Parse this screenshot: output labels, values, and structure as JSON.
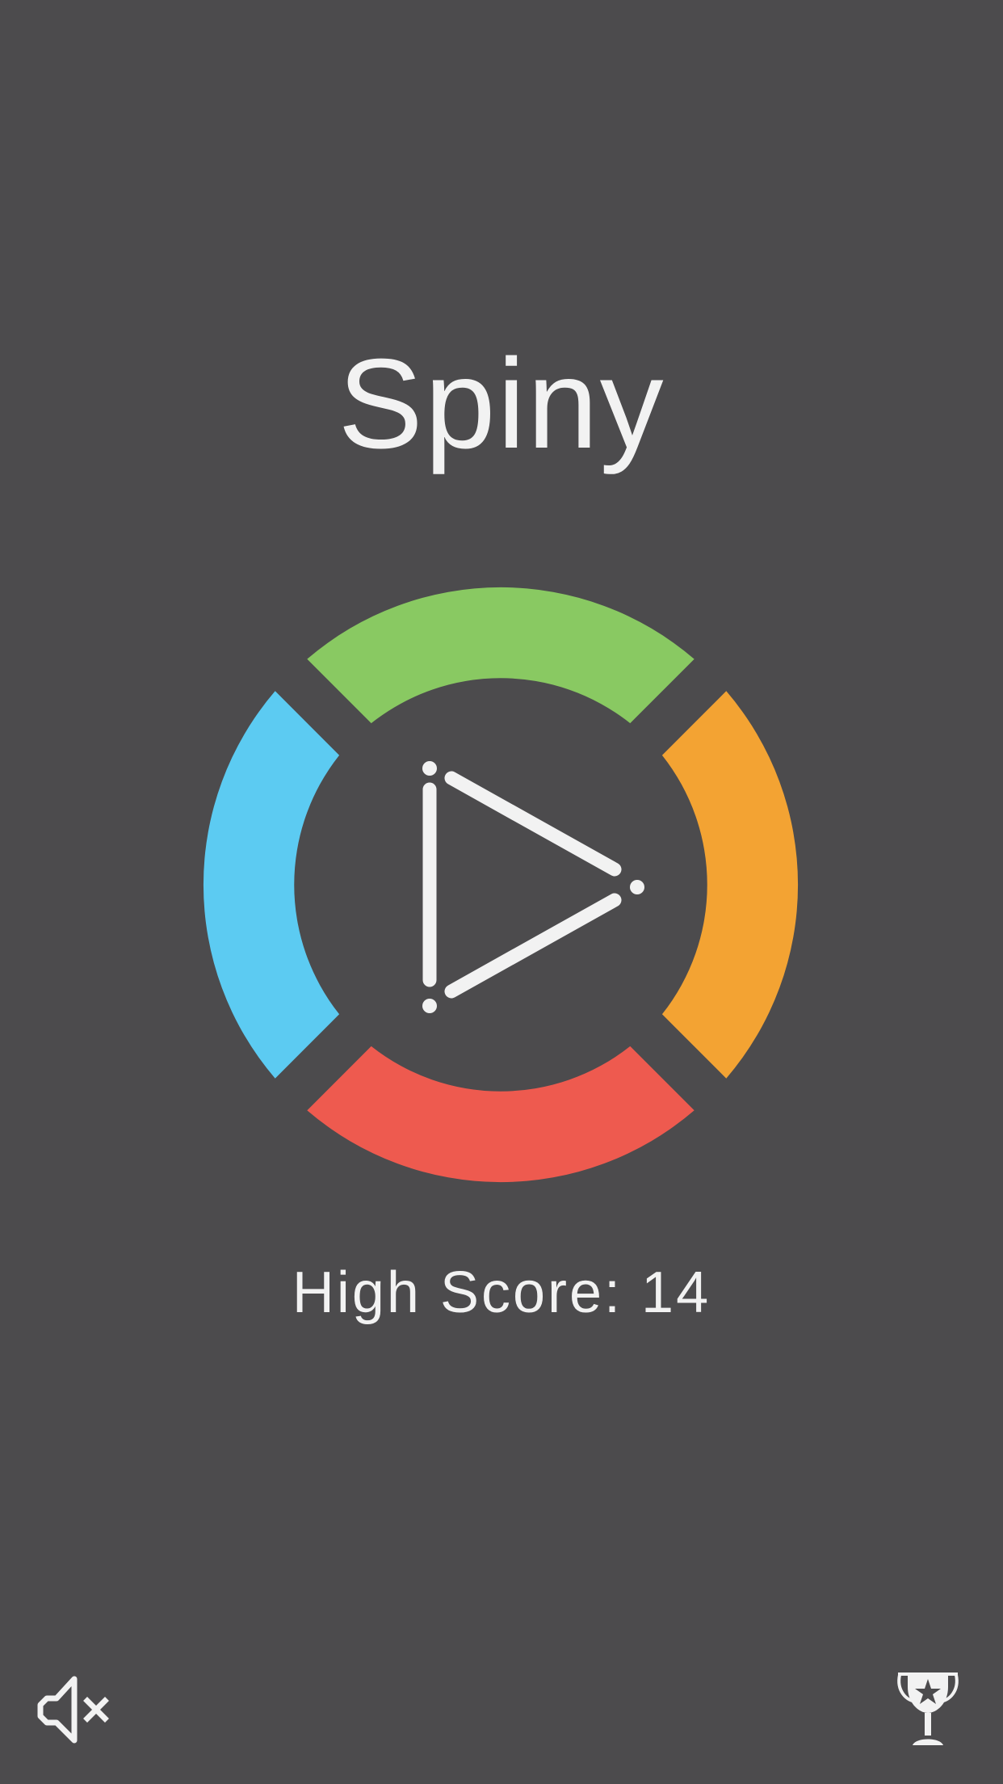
{
  "game": {
    "title": "Spiny",
    "high_score_text": "High Score: 14"
  },
  "wheel": {
    "colors": {
      "top": "#89c962",
      "right": "#f3a333",
      "bottom": "#ee5a4f",
      "left": "#5ccbf2"
    },
    "play_icon_color": "#f2f2f2"
  },
  "controls": {
    "sound_icon": "sound-muted-icon",
    "leaderboard_icon": "trophy-icon"
  },
  "colors": {
    "background": "#4c4b4d",
    "text": "#f2f2f2"
  }
}
